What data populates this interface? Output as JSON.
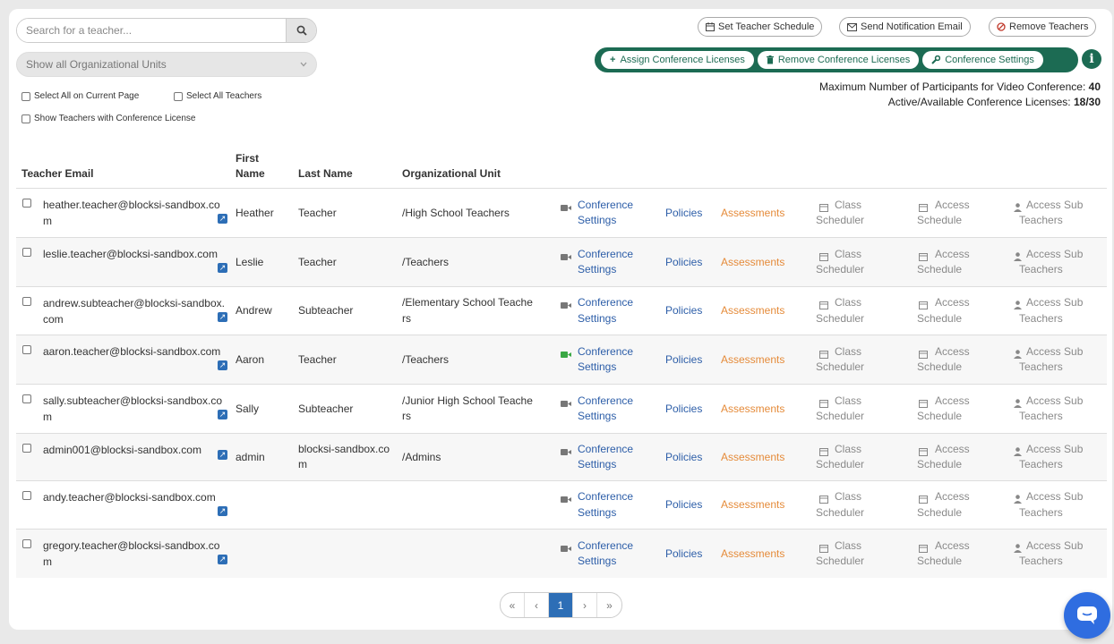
{
  "search": {
    "placeholder": "Search for a teacher..."
  },
  "org_select": {
    "value": "Show all Organizational Units"
  },
  "checks": {
    "select_page": "Select All on Current Page",
    "select_all": "Select All Teachers",
    "show_license": "Show Teachers with Conference License"
  },
  "toolbar": {
    "set_schedule": "Set Teacher Schedule",
    "send_email": "Send Notification Email",
    "remove_teachers": "Remove Teachers",
    "assign_licenses": "Assign Conference Licenses",
    "remove_licenses": "Remove Conference Licenses",
    "conf_settings": "Conference Settings"
  },
  "stats": {
    "max_label": "Maximum Number of Participants for Video Conference:",
    "max_value": "40",
    "lic_label": "Active/Available Conference Licenses:",
    "lic_value": "18/30"
  },
  "table": {
    "headers": {
      "email": "Teacher Email",
      "first": "First\nName",
      "last": "Last Name",
      "ou": "Organizational Unit"
    },
    "link_labels": {
      "conference": "Conference\nSettings",
      "policies": "Policies",
      "assessments": "Assessments",
      "class": "Class\nScheduler",
      "access": "Access\nSchedule",
      "sub": "Access Sub\nTeachers"
    },
    "rows": [
      {
        "email": "heather.teacher@blocksi-sandbox.com",
        "first": "Heather",
        "last": "Teacher",
        "ou": "/High School Teachers",
        "video_active": false
      },
      {
        "email": "leslie.teacher@blocksi-sandbox.com",
        "first": "Leslie",
        "last": "Teacher",
        "ou": "/Teachers",
        "video_active": false
      },
      {
        "email": "andrew.subteacher@blocksi-sandbox.com",
        "first": "Andrew",
        "last": "Subteacher",
        "ou": "/Elementary School Teachers",
        "video_active": false
      },
      {
        "email": "aaron.teacher@blocksi-sandbox.com",
        "first": "Aaron",
        "last": "Teacher",
        "ou": "/Teachers",
        "video_active": true
      },
      {
        "email": "sally.subteacher@blocksi-sandbox.com",
        "first": "Sally",
        "last": "Subteacher",
        "ou": "/Junior High School Teachers",
        "video_active": false
      },
      {
        "email": "admin001@blocksi-sandbox.com",
        "first": "admin",
        "last": "blocksi-sandbox.com",
        "ou": "/Admins",
        "video_active": false
      },
      {
        "email": "andy.teacher@blocksi-sandbox.com",
        "first": "",
        "last": "",
        "ou": "",
        "video_active": false
      },
      {
        "email": "gregory.teacher@blocksi-sandbox.com",
        "first": "",
        "last": "",
        "ou": "",
        "video_active": false
      }
    ]
  },
  "pager": {
    "first": "«",
    "prev": "‹",
    "current": "1",
    "next": "›",
    "last": "»"
  },
  "colors": {
    "accent_green": "#1c6b53",
    "link_blue": "#2d5ea8",
    "orange": "#e58b3a",
    "video_active": "#3aa844"
  }
}
